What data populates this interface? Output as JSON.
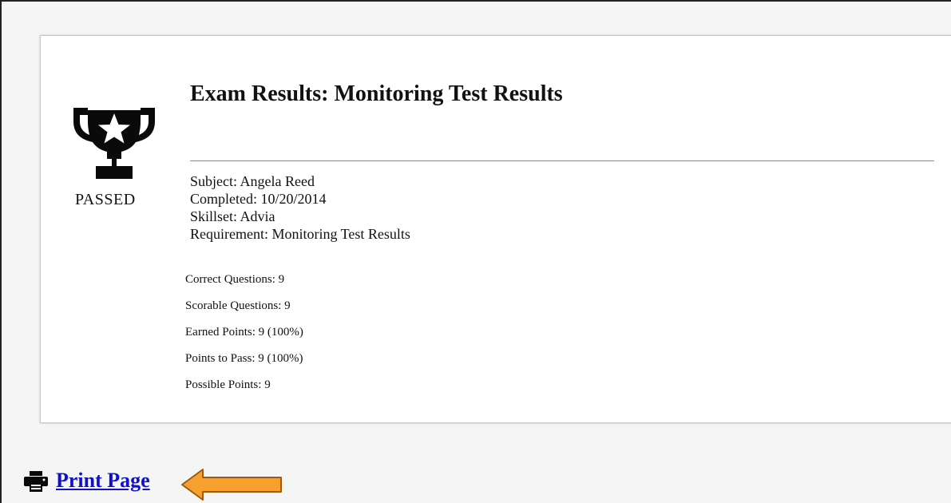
{
  "result": {
    "status": "PASSED",
    "status_icon": "trophy-star-icon",
    "title": "Exam Results: Monitoring Test Results"
  },
  "meta": {
    "subject": "Subject: Angela Reed",
    "completed": "Completed: 10/20/2014",
    "skillset": "Skillset: Advia",
    "requirement": "Requirement: Monitoring Test Results"
  },
  "stats": {
    "correct": "Correct Questions: 9",
    "scorable": "Scorable Questions: 9",
    "earned": "Earned Points: 9 (100%)",
    "to_pass": "Points to Pass: 9 (100%)",
    "possible": "Possible Points: 9"
  },
  "footer": {
    "print_label": "Print Page",
    "print_icon": "printer-icon",
    "pointer_icon": "orange-arrow-icon",
    "pointer_color": "#f7a02e"
  }
}
